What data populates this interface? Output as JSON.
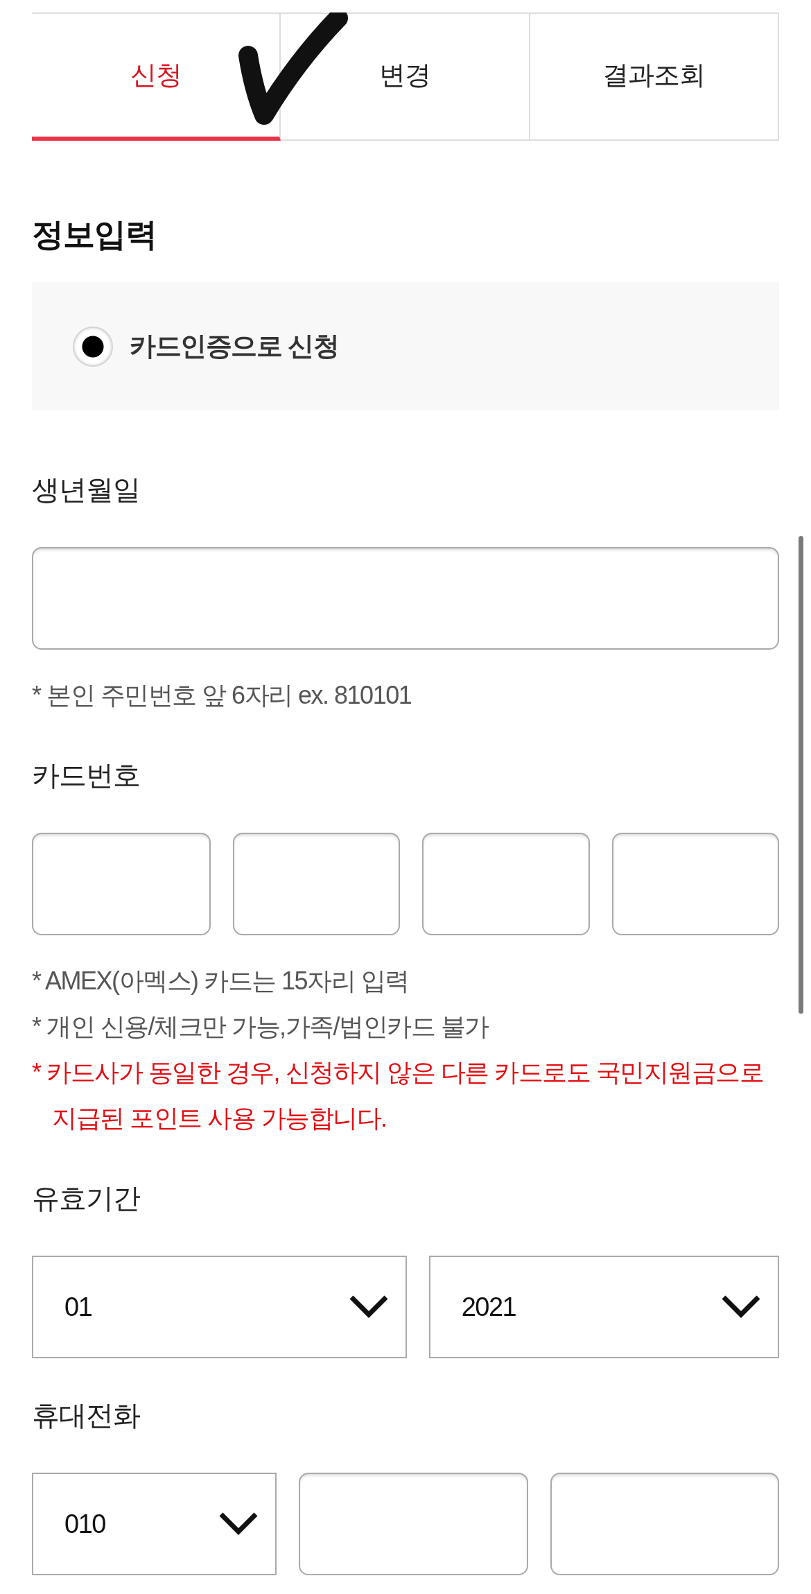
{
  "tabs": [
    {
      "label": "신청",
      "selected": true
    },
    {
      "label": "변경",
      "selected": false
    },
    {
      "label": "결과조회",
      "selected": false
    }
  ],
  "section_title": "정보입력",
  "auth_options": [
    {
      "label": "카드인증으로 신청",
      "selected": true
    }
  ],
  "fields": [
    {
      "label": "생년월일",
      "inputs": [
        {
          "kind": "text"
        }
      ],
      "notes": [
        {
          "kind": "info",
          "text": "* 본인 주민번호 앞 6자리 ex. 810101"
        }
      ]
    },
    {
      "label": "카드번호",
      "inputs": [
        {
          "kind": "text"
        },
        {
          "kind": "text"
        },
        {
          "kind": "text"
        },
        {
          "kind": "text"
        }
      ],
      "notes": [
        {
          "kind": "info",
          "text": "* AMEX(아멕스) 카드는 15자리 입력"
        },
        {
          "kind": "info",
          "text": "* 개인 신용/체크만 가능,가족/법인카드 불가"
        },
        {
          "kind": "warning",
          "text": "* 카드사가 동일한 경우, 신청하지 않은 다른 카드로도 국민지원금으로 지급된 포인트 사용 가능합니다."
        }
      ]
    },
    {
      "label": "유효기간",
      "inputs": [
        {
          "kind": "select",
          "value": "01"
        },
        {
          "kind": "select",
          "value": "2021"
        }
      ]
    },
    {
      "label": "휴대전화",
      "inputs": [
        {
          "kind": "select",
          "value": "010"
        },
        {
          "kind": "text"
        },
        {
          "kind": "text"
        }
      ]
    }
  ]
}
